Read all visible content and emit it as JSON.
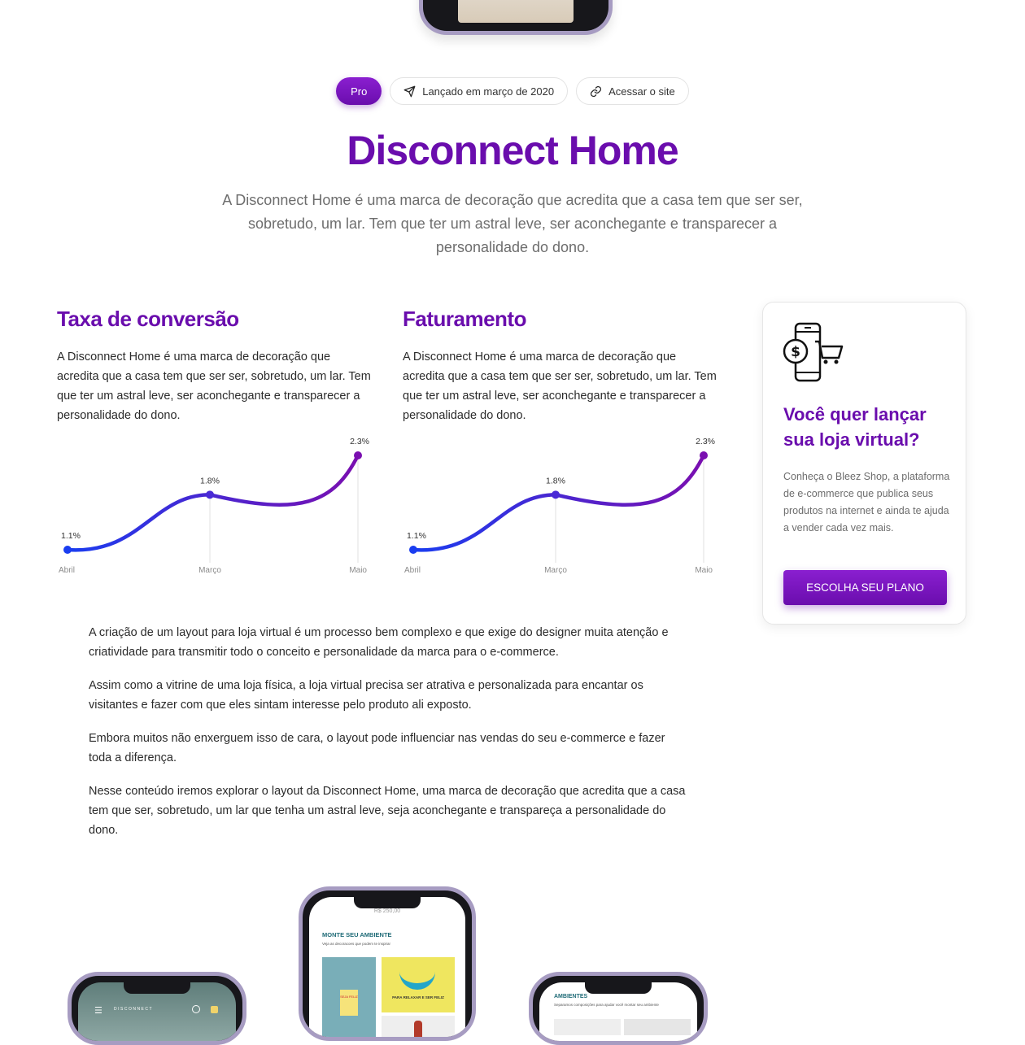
{
  "tags": {
    "pro": "Pro",
    "launch": "Lançado em março de 2020",
    "site": "Acessar o site"
  },
  "hero": {
    "title": "Disconnect Home",
    "intro": "A Disconnect Home é uma marca de decoração que acredita que a casa tem que ser ser, sobretudo, um lar. Tem que ter um astral leve, ser aconchegante e transparecer a personalidade do dono."
  },
  "metrics": [
    {
      "title": "Taxa de conversão",
      "text": "A Disconnect Home é uma marca de decoração que acredita que a casa tem que ser ser, sobretudo, um lar. Tem que ter um astral leve, ser aconchegante e transparecer a personalidade do dono."
    },
    {
      "title": "Faturamento",
      "text": "A Disconnect Home é uma marca de decoração que acredita que a casa tem que ser ser, sobretudo, um lar. Tem que ter um astral leve, ser aconchegante e transparecer a personalidade do dono."
    }
  ],
  "chart_data": [
    {
      "type": "line",
      "categories": [
        "Abril",
        "Março",
        "Maio"
      ],
      "values": [
        1.1,
        1.8,
        2.3
      ],
      "data_labels": [
        "1.1%",
        "1.8%",
        "2.3%"
      ],
      "unit": "%",
      "grid": false,
      "colors": [
        "#1a3df0",
        "#7a0fb0"
      ]
    },
    {
      "type": "line",
      "categories": [
        "Abril",
        "Março",
        "Maio"
      ],
      "values": [
        1.1,
        1.8,
        2.3
      ],
      "data_labels": [
        "1.1%",
        "1.8%",
        "2.3%"
      ],
      "unit": "%",
      "grid": false,
      "colors": [
        "#1a3df0",
        "#7a0fb0"
      ]
    }
  ],
  "card": {
    "icon": "mobile-shop-icon",
    "title": "Você quer lançar sua loja virtual?",
    "text": "Conheça o Bleez Shop, a plataforma de e-commerce que publica seus produtos na internet e ainda te ajuda a vender cada vez mais.",
    "button": "ESCOLHA SEU PLANO"
  },
  "body": [
    "A criação de um layout para loja virtual é um processo bem complexo e que exige do designer muita atenção e criatividade para transmitir todo o conceito e personalidade da marca para o e-commerce.",
    "Assim como a vitrine de uma loja física, a loja virtual precisa ser atrativa e personalizada para encantar os visitantes e fazer com que eles sintam interesse pelo produto ali exposto.",
    "Embora muitos não enxerguem isso de cara, o layout pode influenciar nas vendas do seu e-commerce e fazer toda a diferença.",
    "Nesse conteúdo iremos explorar o layout da Disconnect Home, uma marca de decoração que acredita que a casa tem que ser, sobretudo, um lar que tenha um astral leve, seja aconchegante e transpareça a personalidade do dono."
  ],
  "phones": {
    "left": {
      "brand": "DISCONNECT"
    },
    "center": {
      "price": "R$ 250,00",
      "title": "MONTE SEU AMBIENTE",
      "subtitle": "Veja as decoracoes que podem te inspirar",
      "tile": "PARA RELAXAR E SER FELIZ",
      "poster": "SEJA FELIZ"
    },
    "right": {
      "title": "AMBIENTES",
      "subtitle": "Separamos composições para ajudar você montar seu ambiente"
    }
  },
  "colors": {
    "brand": "#6a0dad",
    "line_start": "#1a3df0",
    "line_end": "#7a0fb0",
    "phone_frame": "#a79cc2"
  }
}
